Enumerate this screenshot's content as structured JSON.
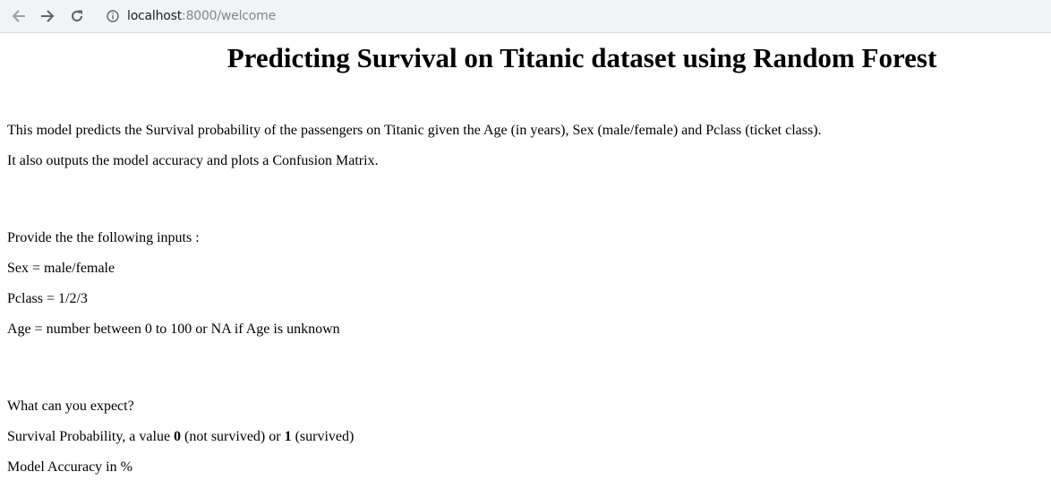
{
  "browser": {
    "url_host": "localhost",
    "url_path": ":8000/welcome",
    "icons": {
      "back": "arrow-left-icon",
      "forward": "arrow-right-icon",
      "reload": "reload-icon",
      "site_info": "info-icon"
    }
  },
  "page": {
    "title": "Predicting Survival on Titanic dataset using Random Forest",
    "intro_1": "This model predicts the Survival probability of the passengers on Titanic given the Age (in years), Sex (male/female) and Pclass (ticket class).",
    "intro_2": "It also outputs the model accuracy and plots a Confusion Matrix.",
    "inputs_heading": "Provide the the following inputs :",
    "input_sex": "Sex = male/female",
    "input_pclass": "Pclass = 1/2/3",
    "input_age": "Age = number between 0 to 100 or NA if Age is unknown",
    "expect_heading": "What can you expect?",
    "survival_prefix": "Survival Probability, a value ",
    "survival_zero": "0",
    "survival_mid": " (not survived) or ",
    "survival_one": "1",
    "survival_suffix": " (survived)",
    "accuracy": "Model Accuracy in %"
  }
}
